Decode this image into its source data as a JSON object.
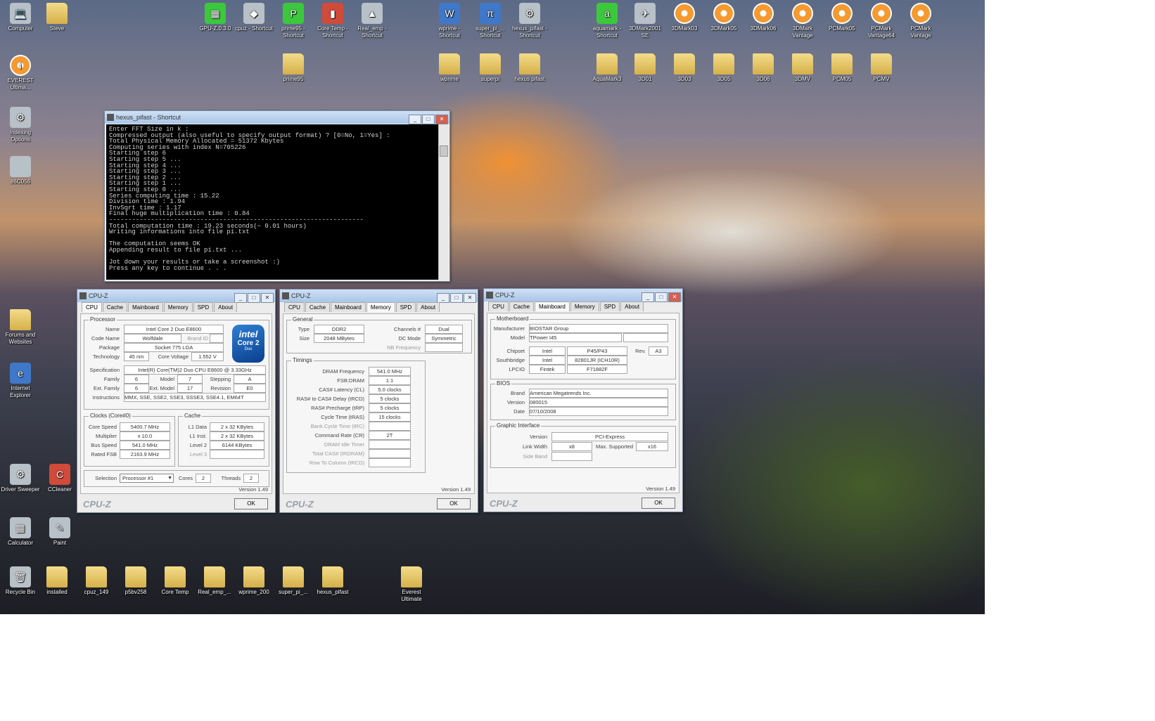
{
  "desktop_icons": [
    {
      "label": "Computer",
      "glyph": "💻",
      "style": "gray"
    },
    {
      "label": "Steve",
      "glyph": "",
      "style": "folder"
    },
    {
      "label": "EVEREST Ultima...",
      "glyph": "i",
      "style": "orange"
    },
    {
      "label": "Indexing Options",
      "glyph": "⚙",
      "style": "gray"
    },
    {
      "label": "86C056",
      "glyph": "",
      "style": "gray"
    },
    {
      "label": "Forums and Websites",
      "glyph": "",
      "style": "folder"
    },
    {
      "label": "Internet Explorer",
      "glyph": "e",
      "style": "blue"
    },
    {
      "label": "Driver Sweeper",
      "glyph": "⚙",
      "style": "gray"
    },
    {
      "label": "CCleaner",
      "glyph": "C",
      "style": "red"
    },
    {
      "label": "Calculator",
      "glyph": "▦",
      "style": "gray"
    },
    {
      "label": "Paint",
      "glyph": "✎",
      "style": "gray"
    },
    {
      "label": "Recycle Bin",
      "glyph": "🗑",
      "style": "gray"
    },
    {
      "label": "installed",
      "glyph": "",
      "style": "folder"
    },
    {
      "label": "cpuz_149",
      "glyph": "",
      "style": "folder"
    },
    {
      "label": "p5bv258",
      "glyph": "",
      "style": "folder"
    },
    {
      "label": "Core Temp",
      "glyph": "",
      "style": "folder"
    },
    {
      "label": "Real_emp_...",
      "glyph": "",
      "style": "folder"
    },
    {
      "label": "wprime_200",
      "glyph": "",
      "style": "folder"
    },
    {
      "label": "super_pi_...",
      "glyph": "",
      "style": "folder"
    },
    {
      "label": "hexus_pifast",
      "glyph": "",
      "style": "folder"
    },
    {
      "label": "Everest Ultimate",
      "glyph": "",
      "style": "folder"
    },
    {
      "label": "GPU-Z.0.3.0",
      "glyph": "▦",
      "style": "green"
    },
    {
      "label": "cpuz - Shortcut",
      "glyph": "◆",
      "style": "gray"
    },
    {
      "label": "prime95 - Shortcut",
      "glyph": "P",
      "style": "green"
    },
    {
      "label": "Core Temp - Shortcut",
      "glyph": "▮",
      "style": "red"
    },
    {
      "label": "Real_emp - Shortcut",
      "glyph": "▲",
      "style": "gray"
    },
    {
      "label": "wprime - Shortcut",
      "glyph": "W",
      "style": "blue"
    },
    {
      "label": "super_pi_... Shortcut",
      "glyph": "π",
      "style": "blue"
    },
    {
      "label": "hexus_pifast - Shortcut",
      "glyph": "⚙",
      "style": "gray"
    },
    {
      "label": "aquamark - Shortcut",
      "glyph": "a",
      "style": "green"
    },
    {
      "label": "3DMark2001 SE",
      "glyph": "✈",
      "style": "gray"
    },
    {
      "label": "3DMark03",
      "glyph": "",
      "style": "orange"
    },
    {
      "label": "3DMark05",
      "glyph": "",
      "style": "orange"
    },
    {
      "label": "3DMark06",
      "glyph": "",
      "style": "orange"
    },
    {
      "label": "3DMark Vantage",
      "glyph": "",
      "style": "orange"
    },
    {
      "label": "PCMark05",
      "glyph": "",
      "style": "orange"
    },
    {
      "label": "PCMark Vantage64",
      "glyph": "",
      "style": "orange"
    },
    {
      "label": "PCMark Vantage",
      "glyph": "",
      "style": "orange"
    },
    {
      "label": "prime95",
      "glyph": "",
      "style": "folder"
    },
    {
      "label": "wprime",
      "glyph": "",
      "style": "folder"
    },
    {
      "label": "superpi",
      "glyph": "",
      "style": "folder"
    },
    {
      "label": "hexus pifast",
      "glyph": "",
      "style": "folder"
    },
    {
      "label": "AquaMark3",
      "glyph": "",
      "style": "folder"
    },
    {
      "label": "3D01",
      "glyph": "",
      "style": "folder"
    },
    {
      "label": "3D03",
      "glyph": "",
      "style": "folder"
    },
    {
      "label": "3D05",
      "glyph": "",
      "style": "folder"
    },
    {
      "label": "3D06",
      "glyph": "",
      "style": "folder"
    },
    {
      "label": "3DMV",
      "glyph": "",
      "style": "folder"
    },
    {
      "label": "PCM05",
      "glyph": "",
      "style": "folder"
    },
    {
      "label": "PCMV",
      "glyph": "",
      "style": "folder"
    }
  ],
  "console": {
    "title": "hexus_pifast - Shortcut",
    "lines": [
      "Enter FFT Size in k :",
      "Compressed output (also useful to specify output format) ? [0=No, 1=Yes] :",
      "Total Physical Memory Allocated = 51372 Kbytes",
      "Computing series with index N=705226",
      "Starting step 6",
      "Starting step 5 ...",
      "Starting step 4 ...",
      "Starting step 3 ...",
      "Starting step 2 ...",
      "Starting step 1 ...",
      "Starting step 0 ...",
      "Series computing time : 15.22",
      "Division time : 1.94",
      "InvSqrt time : 1.17",
      "Final huge multiplication time : 0.84",
      "-------------------------------------------------------------------",
      "Total computation time : 19.23 seconds(~ 0.01 hours)",
      "Writing informations into file pi.txt",
      "",
      "The computation seems OK",
      "Appending result to file pi.txt ...",
      "",
      "Jot down your results or take a screenshot :)",
      "Press any key to continue . . ."
    ]
  },
  "cpuz_common": {
    "title": "CPU-Z",
    "tabs": [
      "CPU",
      "Cache",
      "Mainboard",
      "Memory",
      "SPD",
      "About"
    ],
    "version": "Version 1.49",
    "ok": "OK",
    "brand": "CPU-Z"
  },
  "cpu_tab": {
    "processor_group": "Processor",
    "name_label": "Name",
    "name": "Intel Core 2 Duo E8600",
    "codename_label": "Code Name",
    "codename": "Wolfdale",
    "brandid_label": "Brand ID",
    "package_label": "Package",
    "package": "Socket 775 LGA",
    "technology_label": "Technology",
    "technology": "45 nm",
    "corevoltage_label": "Core Voltage",
    "corevoltage": "1.552 V",
    "spec_label": "Specification",
    "spec": "Intel(R) Core(TM)2 Duo CPU     E8600  @ 3.33GHz",
    "family_label": "Family",
    "family": "6",
    "model_label": "Model",
    "model": "7",
    "stepping_label": "Stepping",
    "stepping": "A",
    "extfamily_label": "Ext. Family",
    "extfamily": "6",
    "extmodel_label": "Ext. Model",
    "extmodel": "17",
    "revision_label": "Revision",
    "revision": "E0",
    "instructions_label": "Instructions",
    "instructions": "MMX, SSE, SSE2, SSE3, SSSE3, SSE4.1, EM64T",
    "clocks_group": "Clocks (Core#0)",
    "corespeed_label": "Core Speed",
    "corespeed": "5400.7 MHz",
    "multiplier_label": "Multiplier",
    "multiplier": "x 10.0",
    "busspeed_label": "Bus Speed",
    "busspeed": "541.0 MHz",
    "ratedfsb_label": "Rated FSB",
    "ratedfsb": "2163.9 MHz",
    "cache_group": "Cache",
    "l1data_label": "L1 Data",
    "l1data": "2 x 32 KBytes",
    "l1inst_label": "L1 Inst.",
    "l1inst": "2 x 32 KBytes",
    "level2_label": "Level 2",
    "level2": "6144 KBytes",
    "level3_label": "Level 3",
    "selection_label": "Selection",
    "selection": "Processor #1",
    "cores_label": "Cores",
    "cores": "2",
    "threads_label": "Threads",
    "threads": "2",
    "logo_brand": "intel",
    "logo_line": "Core 2",
    "logo_sub": "Duo"
  },
  "memory_tab": {
    "general_group": "General",
    "type_label": "Type",
    "type": "DDR2",
    "size_label": "Size",
    "size": "2048 MBytes",
    "channels_label": "Channels #",
    "channels": "Dual",
    "dcmode_label": "DC Mode",
    "dcmode": "Symmetric",
    "nbfreq_label": "NB Frequency",
    "timings_group": "Timings",
    "rows": [
      {
        "label": "DRAM Frequency",
        "value": "541.0 MHz",
        "dim": false
      },
      {
        "label": "FSB:DRAM",
        "value": "1:1",
        "dim": false
      },
      {
        "label": "CAS# Latency (CL)",
        "value": "5.0 clocks",
        "dim": false
      },
      {
        "label": "RAS# to CAS# Delay (tRCD)",
        "value": "5 clocks",
        "dim": false
      },
      {
        "label": "RAS# Precharge (tRP)",
        "value": "5 clocks",
        "dim": false
      },
      {
        "label": "Cycle Time (tRAS)",
        "value": "15 clocks",
        "dim": false
      },
      {
        "label": "Bank Cycle Time (tRC)",
        "value": "",
        "dim": true
      },
      {
        "label": "Command Rate (CR)",
        "value": "2T",
        "dim": false
      },
      {
        "label": "DRAM Idle Timer",
        "value": "",
        "dim": true
      },
      {
        "label": "Total CAS# (tRDRAM)",
        "value": "",
        "dim": true
      },
      {
        "label": "Row To Column (tRCD)",
        "value": "",
        "dim": true
      }
    ]
  },
  "mainboard_tab": {
    "mb_group": "Motherboard",
    "manufacturer_label": "Manufacturer",
    "manufacturer": "BIOSTAR Group",
    "model_label": "Model",
    "model": "TPower I45",
    "chipset_label": "Chipset",
    "chipset_vendor": "Intel",
    "chipset": "P45/P43",
    "rev_label": "Rev.",
    "rev": "A3",
    "southbridge_label": "Southbridge",
    "sb_vendor": "Intel",
    "southbridge": "82801JR (ICH10R)",
    "lpcio_label": "LPCIO",
    "lpcio_vendor": "Fintek",
    "lpcio": "F71882F",
    "bios_group": "BIOS",
    "brand_label": "Brand",
    "brand": "American Megatrends Inc.",
    "version_label": "Version",
    "version": "080015",
    "date_label": "Date",
    "date": "07/10/2008",
    "gi_group": "Graphic Interface",
    "giversion_label": "Version",
    "giversion": "PCI-Express",
    "linkwidth_label": "Link Width",
    "linkwidth": "x8",
    "maxsupported_label": "Max. Supported",
    "maxsupported": "x16",
    "sideband_label": "Side Band"
  }
}
